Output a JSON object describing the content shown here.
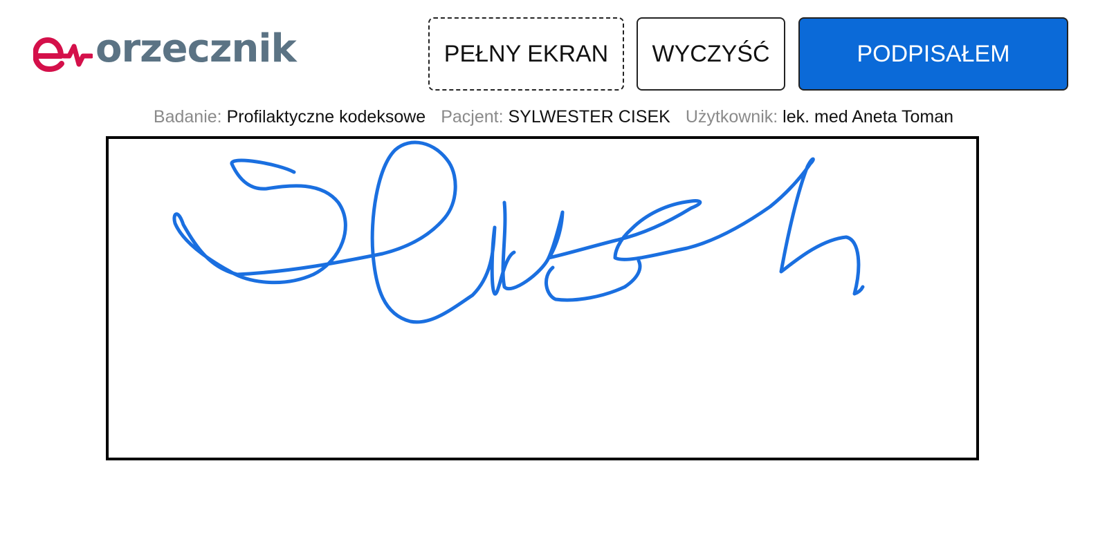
{
  "app": {
    "logo_text": "orzecznik",
    "brand_color": "#d4104a",
    "logo_text_color": "#5b7384"
  },
  "toolbar": {
    "fullscreen_label": "PEŁNY EKRAN",
    "clear_label": "WYCZYŚĆ",
    "signed_label": "PODPISAŁEM",
    "signed_color": "#0b6ad8"
  },
  "info": {
    "exam_label": "Badanie:",
    "exam_value": "Profilaktyczne kodeksowe",
    "patient_label": "Pacjent:",
    "patient_value": "SYLWESTER CISEK",
    "user_label": "Użytkownik:",
    "user_value": "lek. med Aneta Toman"
  },
  "signature": {
    "ink_color": "#1a6fe0"
  }
}
